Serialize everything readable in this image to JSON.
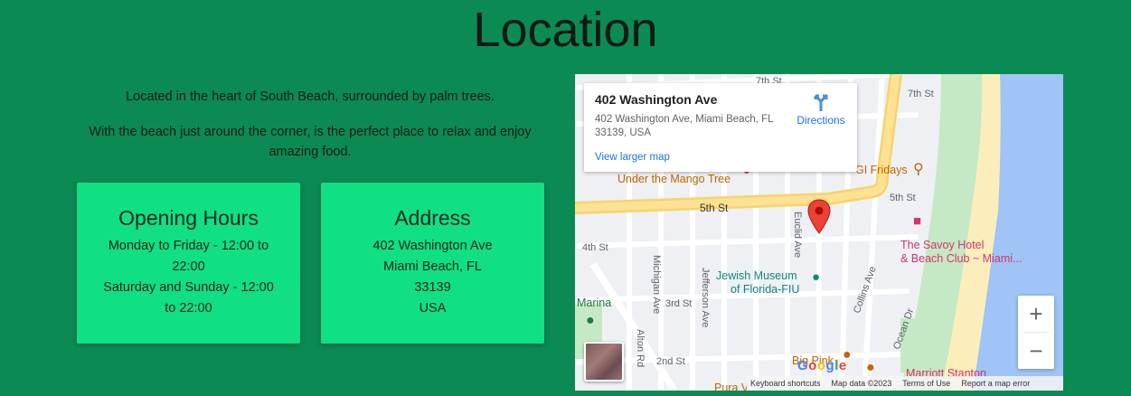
{
  "heading": "Location",
  "intro": {
    "p1": "Located in the heart of South Beach, surrounded by palm trees.",
    "p2": "With the beach just around the corner, is the perfect place to relax and enjoy amazing food."
  },
  "hours": {
    "title": "Opening Hours",
    "line1": "Monday to Friday - 12:00 to",
    "line2": "22:00",
    "line3": "Saturday and Sunday - 12:00",
    "line4": "to 22:00"
  },
  "address": {
    "title": "Address",
    "line1": "402 Washington Ave",
    "line2": "Miami Beach, FL",
    "line3": "33139",
    "line4": "USA"
  },
  "map": {
    "info_name": "402 Washington Ave",
    "info_address": "402 Washington Ave, Miami Beach, FL 33139, USA",
    "directions": "Directions",
    "view_larger": "View larger map",
    "zoom_in": "+",
    "zoom_out": "−",
    "google": "Google",
    "footer": {
      "shortcuts": "Keyboard shortcuts",
      "data": "Map data ©2023",
      "terms": "Terms of Use",
      "report": "Report a map error"
    },
    "streets": {
      "seventh_top": "7th St",
      "seventh_right": "7th St",
      "fifth": "5th St",
      "fifth_right": "5th St",
      "fourth": "4th St",
      "third": "3rd St",
      "second": "2nd St",
      "euclid": "Euclid Ave",
      "michigan": "Michigan Ave",
      "jefferson": "Jefferson Ave",
      "collins": "Collins Ave",
      "ocean": "Ocean Dr",
      "alton": "Alton Rd"
    },
    "pois": {
      "mango": "Under the Mango Tree",
      "fridays": "GI Fridays",
      "savoy1": "The Savoy Hotel",
      "savoy2": "& Beach Club ~ Miami...",
      "jewish1": "Jewish Museum",
      "jewish2": "of Florida-FIU",
      "marina": "Marina",
      "bigpink": "Big Pink",
      "marriott": "Marriott Stanton",
      "pura": "Pura V"
    }
  },
  "colors": {
    "background": "#0c8a53",
    "card": "#11df83",
    "link": "#1a73e8"
  }
}
